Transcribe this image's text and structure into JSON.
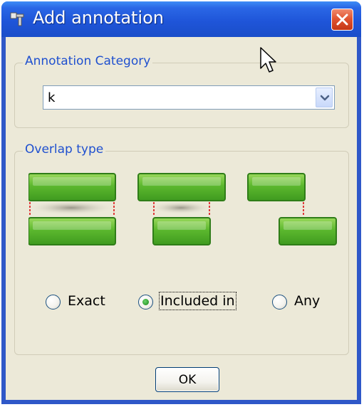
{
  "window": {
    "title": "Add annotation",
    "title_icon": "annotation-pin-icon",
    "close_icon": "close-icon",
    "colors": {
      "titlebar": "#2a67e6",
      "close": "#e15532",
      "client": "#ece9d8",
      "legend": "#1f50cf"
    }
  },
  "annotation_category": {
    "legend": "Annotation Category",
    "selected_value": "k",
    "dropdown_icon": "chevron-down-icon"
  },
  "overlap_type": {
    "legend": "Overlap type",
    "options": [
      {
        "label": "Exact",
        "selected": false
      },
      {
        "label": "Included in",
        "selected": true
      },
      {
        "label": "Any",
        "selected": false
      }
    ],
    "diagram_colors": {
      "bar": "#5cb82e",
      "bar_border": "#2f7d18",
      "connector": "#e03a3a"
    }
  },
  "buttons": {
    "ok": "OK"
  },
  "cursor_icon": "mouse-pointer-icon"
}
